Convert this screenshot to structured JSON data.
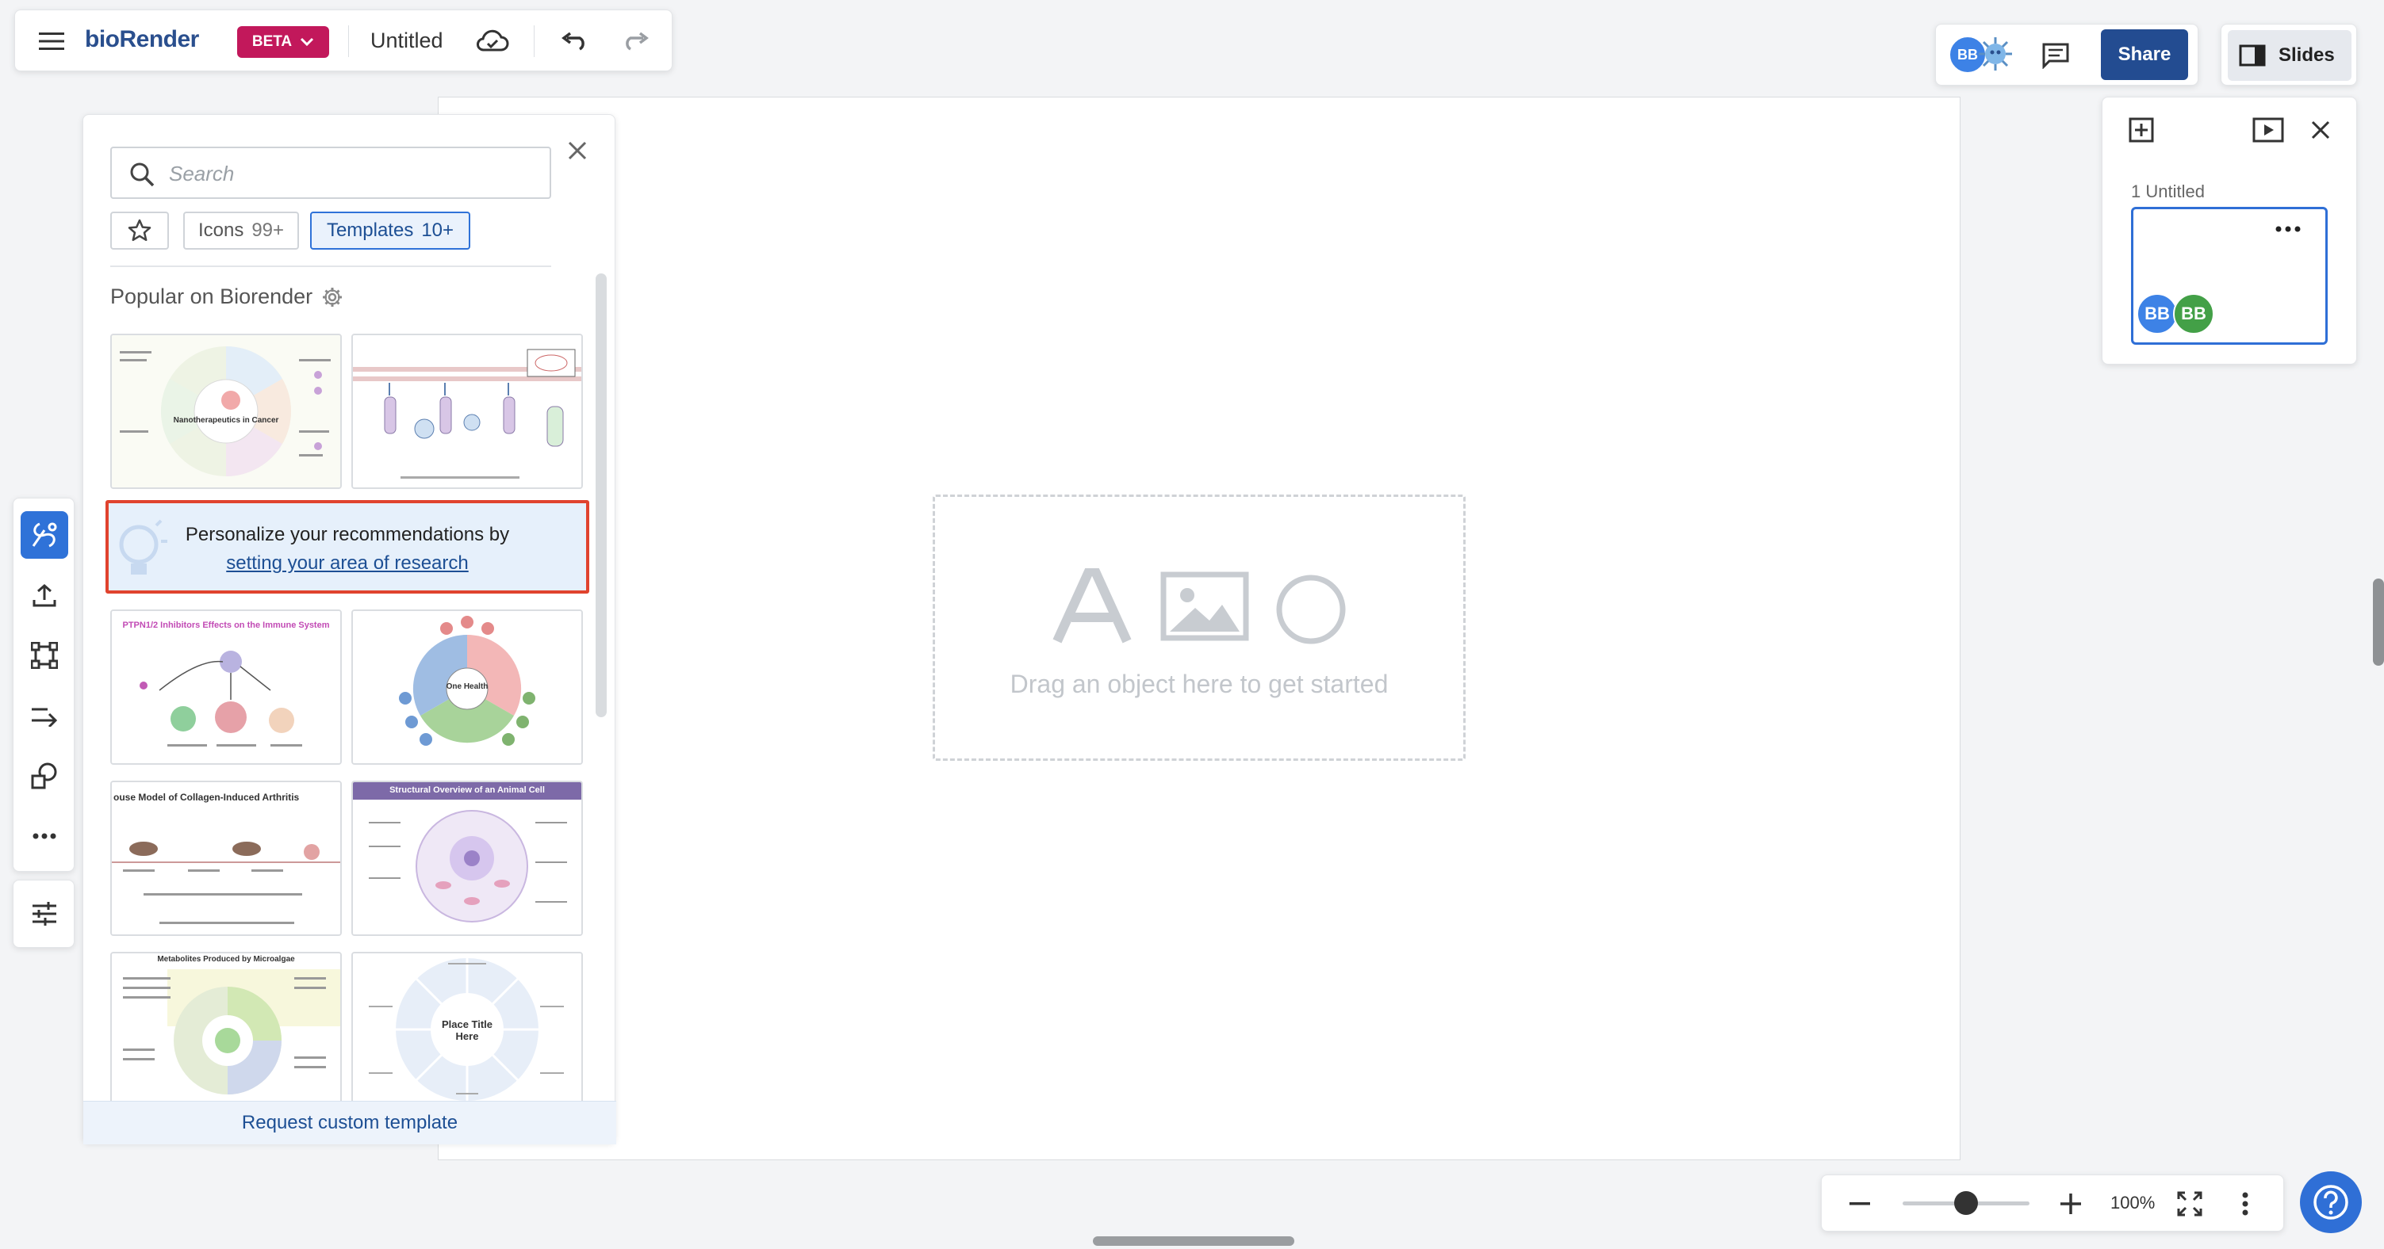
{
  "app": {
    "logo": "bioRender",
    "beta_label": "BETA",
    "doc_title": "Untitled"
  },
  "collab": {
    "avatar_initials": "BB",
    "share_label": "Share"
  },
  "slides": {
    "toggle_label": "Slides",
    "slide_label": "1 Untitled",
    "avatars": [
      "BB",
      "BB"
    ]
  },
  "canvas": {
    "drop_text": "Drag an object here to get started"
  },
  "library": {
    "search_placeholder": "Search",
    "tabs": [
      {
        "label": "Icons",
        "count": "99+"
      },
      {
        "label": "Templates",
        "count": "10+"
      }
    ],
    "section_title": "Popular on Biorender",
    "recommendation": {
      "text": "Personalize your recommendations by",
      "link": "setting your area of research"
    },
    "templates": [
      {
        "title": "Nanotherapeutics in Cancer"
      },
      {
        "title": ""
      },
      {
        "title": "PTPN1/2 Inhibitors Effects on the Immune System"
      },
      {
        "title": "One Health"
      },
      {
        "title": "ouse Model of Collagen-Induced Arthritis"
      },
      {
        "title": "Structural Overview of an Animal Cell"
      },
      {
        "title": "Metabolites Produced by Microalgae"
      },
      {
        "title": "Place Title Here"
      }
    ],
    "footer_link": "Request custom template"
  },
  "zoom": {
    "level": "100%",
    "slider_fraction": 0.5
  },
  "colors": {
    "brand": "#2a4f8e",
    "beta": "#c2185b",
    "accent": "#2f72d8",
    "share": "#234c91",
    "highlight_border": "#e0432e"
  }
}
